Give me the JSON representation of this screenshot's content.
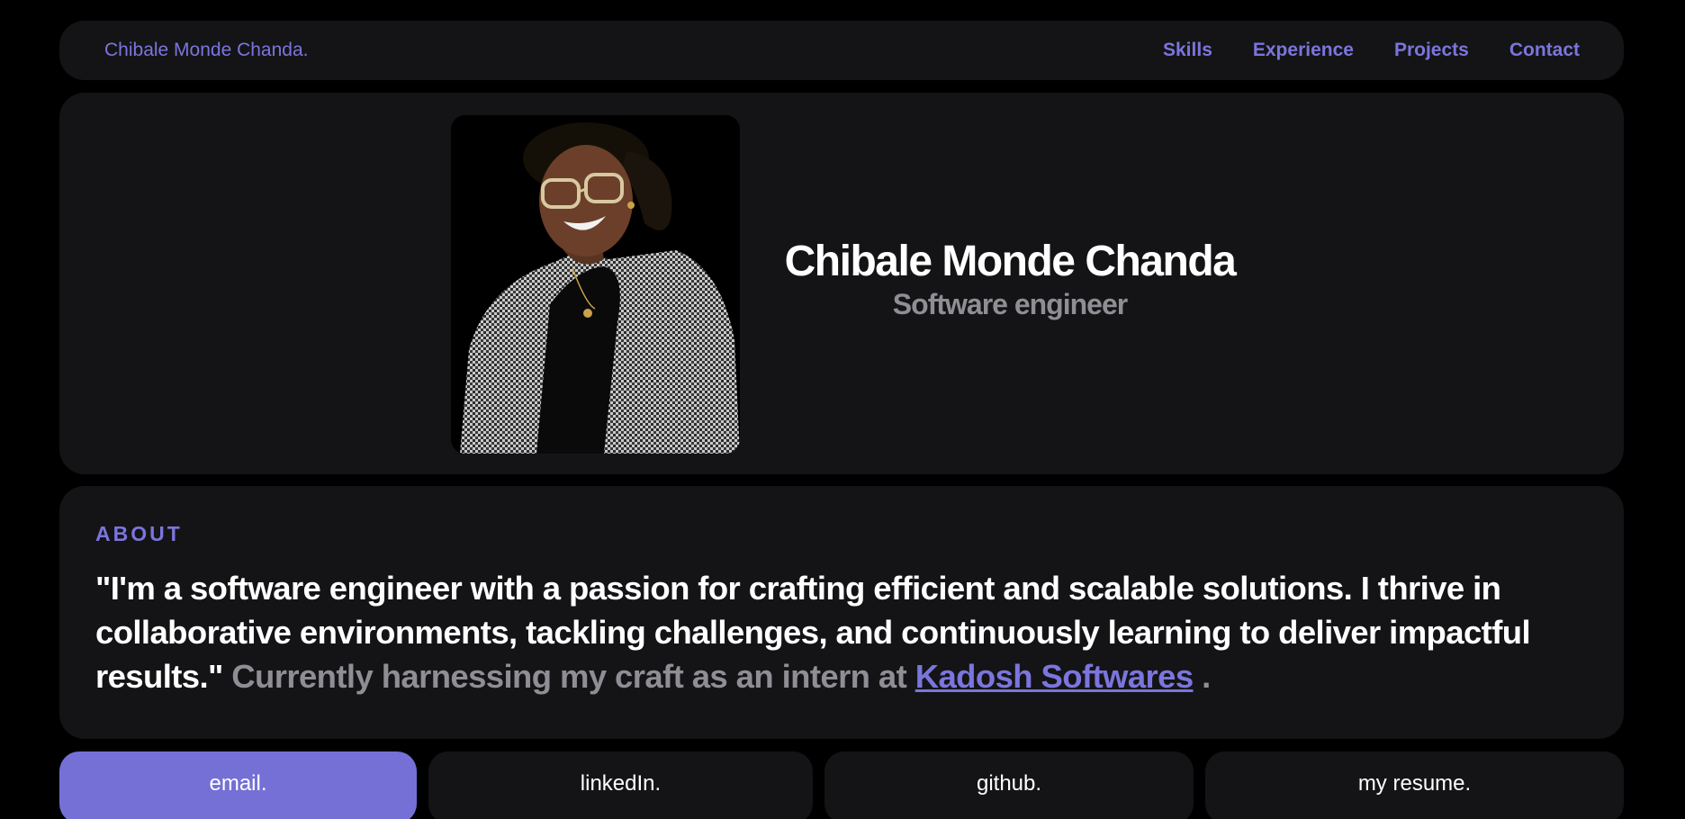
{
  "nav": {
    "brand": "Chibale Monde Chanda.",
    "links": [
      {
        "label": "Skills"
      },
      {
        "label": "Experience"
      },
      {
        "label": "Projects"
      },
      {
        "label": "Contact"
      }
    ]
  },
  "hero": {
    "name": "Chibale Monde Chanda",
    "role": "Software engineer"
  },
  "about": {
    "label": "ABOUT",
    "quote": "\"I'm a software engineer with a passion for crafting efficient and scalable solutions. I thrive in collaborative environments, tackling challenges, and continuously learning to deliver impactful results.\"",
    "current_prefix": "Currently harnessing my craft as an intern at",
    "company_link": "Kadosh Softwares",
    "current_suffix": "."
  },
  "buttons": [
    {
      "label": "email."
    },
    {
      "label": "linkedIn."
    },
    {
      "label": "github."
    },
    {
      "label": "my resume."
    }
  ],
  "colors": {
    "accent": "#7b75dd",
    "card": "#141416",
    "background": "#000000",
    "muted_text": "#8e8e94"
  }
}
